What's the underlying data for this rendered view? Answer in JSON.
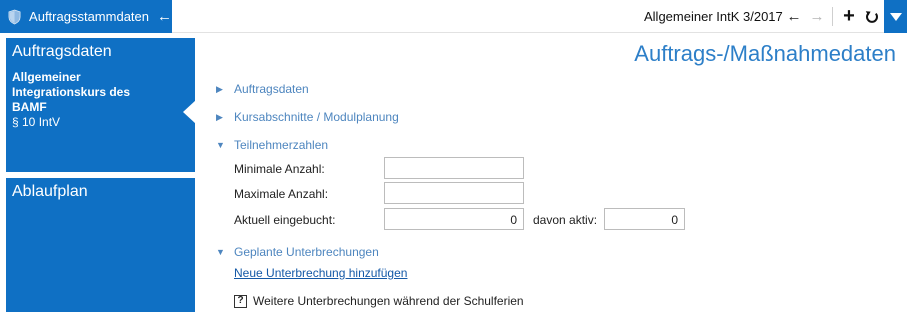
{
  "header": {
    "app_title": "Auftragsstammdaten",
    "back_glyph": "←",
    "context_title": "Allgemeiner IntK 3/2017",
    "nav_back_glyph": "←",
    "nav_forward_glyph": "→",
    "add_glyph": "+",
    "accent_color": "#0f70c4"
  },
  "sidebar": {
    "panel1": {
      "title": "Auftragsdaten",
      "subtitle": "Allgemeiner Integrationskurs des BAMF",
      "paragraph": "§ 10 IntV"
    },
    "panel2": {
      "title": "Ablaufplan"
    }
  },
  "main": {
    "title": "Auftrags-/Maßnahmedaten",
    "sections": {
      "auftragsdaten": {
        "label": "Auftragsdaten",
        "glyph": "▶"
      },
      "kursabschnitte": {
        "label": "Kursabschnitte / Modulplanung",
        "glyph": "▶"
      },
      "teilnehmerzahlen": {
        "label": "Teilnehmerzahlen",
        "glyph": "▼"
      },
      "unterbrechungen": {
        "label": "Geplante Unterbrechungen",
        "glyph": "▼"
      }
    },
    "fields": {
      "min_label": "Minimale Anzahl:",
      "min_value": "",
      "max_label": "Maximale Anzahl:",
      "max_value": "",
      "current_label": "Aktuell eingebucht:",
      "current_value": "0",
      "active_label": "davon aktiv:",
      "active_value": "0"
    },
    "add_interruption_link": "Neue Unterbrechung hinzufügen",
    "holiday_checkbox": {
      "glyph": "?",
      "label": "Weitere Unterbrechungen während der Schulferien"
    }
  }
}
